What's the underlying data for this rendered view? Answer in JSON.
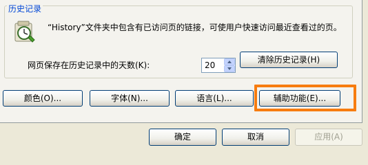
{
  "history": {
    "group_title": "历史记录",
    "description": "“History”文件夹中包含有已访问页的链接，可使用户快速访问最近查看过的页。",
    "days_label": "网页保存在历史记录中的天数(K):",
    "days_value": "20",
    "clear_button": "清除历史记录(H)"
  },
  "bottom_buttons": {
    "colors": "颜色(O)...",
    "fonts": "字体(N)...",
    "languages": "语言(L)...",
    "accessibility": "辅助功能(E)..."
  },
  "dialog_buttons": {
    "ok": "确定",
    "cancel": "取消",
    "apply": "应用(A)"
  },
  "colors": {
    "accent": "#0046d5",
    "highlight_border": "#f77c0f",
    "dialog_bg": "#ece9d8"
  },
  "icons": {
    "history": "history-clock-icon"
  }
}
